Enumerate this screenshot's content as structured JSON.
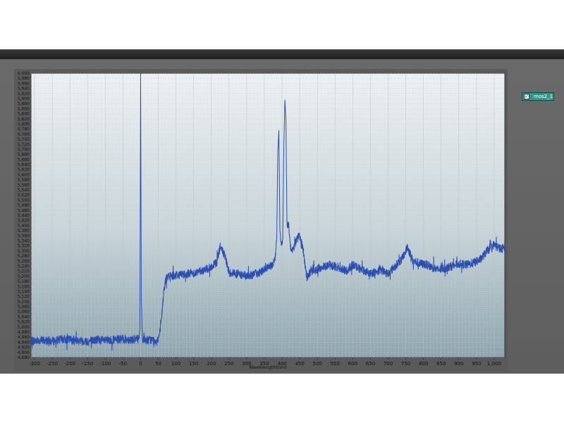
{
  "legend": {
    "label": "mos2_1",
    "checked": true,
    "color": "#2a9a8a"
  },
  "chart_data": {
    "type": "line",
    "title": "",
    "xlabel": "Wavelength(nm)",
    "ylabel": "",
    "xlim": [
      -310,
      1030
    ],
    "ylim": [
      4880,
      6000
    ],
    "grid": true,
    "line_color": "#2a4fb0",
    "x_ticks": [
      -300,
      -250,
      -200,
      -150,
      -100,
      -50,
      0,
      50,
      100,
      150,
      200,
      250,
      300,
      350,
      400,
      450,
      500,
      550,
      600,
      650,
      700,
      750,
      800,
      850,
      900,
      950,
      1000
    ],
    "x_tick_labels": [
      "-300",
      "-250",
      "-200",
      "-150",
      "-100",
      "-50",
      "0",
      "50",
      "100",
      "150",
      "200",
      "250",
      "300",
      "350",
      "400",
      "450",
      "500",
      "550",
      "600",
      "650",
      "700",
      "750",
      "800",
      "850",
      "900",
      "950",
      "1,000"
    ],
    "y_tick_labels": [
      "6,000",
      "5,980",
      "5,960",
      "5,940",
      "5,920",
      "5,900",
      "5,880",
      "5,860",
      "5,840",
      "5,820",
      "5,800",
      "5,780",
      "5,760",
      "5,740",
      "5,720",
      "5,700",
      "5,680",
      "5,660",
      "5,640",
      "5,620",
      "5,600",
      "5,580",
      "5,560",
      "5,540",
      "5,520",
      "5,500",
      "5,480",
      "5,460",
      "5,440",
      "5,420",
      "5,400",
      "5,380",
      "5,360",
      "5,340",
      "5,320",
      "5,300",
      "5,280",
      "5,260",
      "5,240",
      "5,220",
      "5,200",
      "5,180",
      "5,160",
      "5,140",
      "5,120",
      "5,100",
      "5,080",
      "5,060",
      "5,040",
      "5,020",
      "5,000",
      "4,980",
      "4,960",
      "4,940",
      "4,920",
      "4,900",
      "4,880"
    ],
    "series": [
      {
        "name": "mos2_1",
        "x": [
          -310,
          -300,
          -280,
          -250,
          -220,
          -200,
          -180,
          -150,
          -120,
          -100,
          -80,
          -50,
          -20,
          -5,
          -2,
          0,
          2,
          5,
          10,
          20,
          30,
          40,
          50,
          55,
          60,
          65,
          70,
          80,
          100,
          130,
          160,
          180,
          200,
          215,
          225,
          232,
          240,
          250,
          270,
          300,
          330,
          350,
          370,
          380,
          385,
          388,
          391,
          394,
          398,
          402,
          405,
          408,
          411,
          414,
          418,
          424,
          430,
          440,
          450,
          460,
          470,
          480,
          500,
          530,
          560,
          580,
          600,
          620,
          650,
          680,
          700,
          720,
          740,
          755,
          770,
          790,
          810,
          840,
          870,
          900,
          920,
          940,
          960,
          980,
          1000,
          1020,
          1030
        ],
        "y": [
          4946,
          4945,
          4948,
          4944,
          4952,
          4950,
          4948,
          4944,
          4950,
          4946,
          4948,
          4952,
          4950,
          4954,
          4990,
          6000,
          5100,
          4955,
          4950,
          4948,
          4950,
          4945,
          4955,
          4980,
          5050,
          5130,
          5185,
          5200,
          5205,
          5210,
          5215,
          5225,
          5235,
          5255,
          5315,
          5300,
          5270,
          5215,
          5210,
          5200,
          5212,
          5225,
          5240,
          5265,
          5350,
          5690,
          5775,
          5380,
          5330,
          5345,
          5710,
          5895,
          5820,
          5400,
          5410,
          5320,
          5300,
          5340,
          5360,
          5300,
          5195,
          5215,
          5228,
          5245,
          5235,
          5220,
          5245,
          5230,
          5212,
          5225,
          5210,
          5240,
          5270,
          5315,
          5260,
          5250,
          5245,
          5225,
          5235,
          5250,
          5245,
          5252,
          5265,
          5300,
          5325,
          5305,
          5320
        ]
      }
    ]
  }
}
